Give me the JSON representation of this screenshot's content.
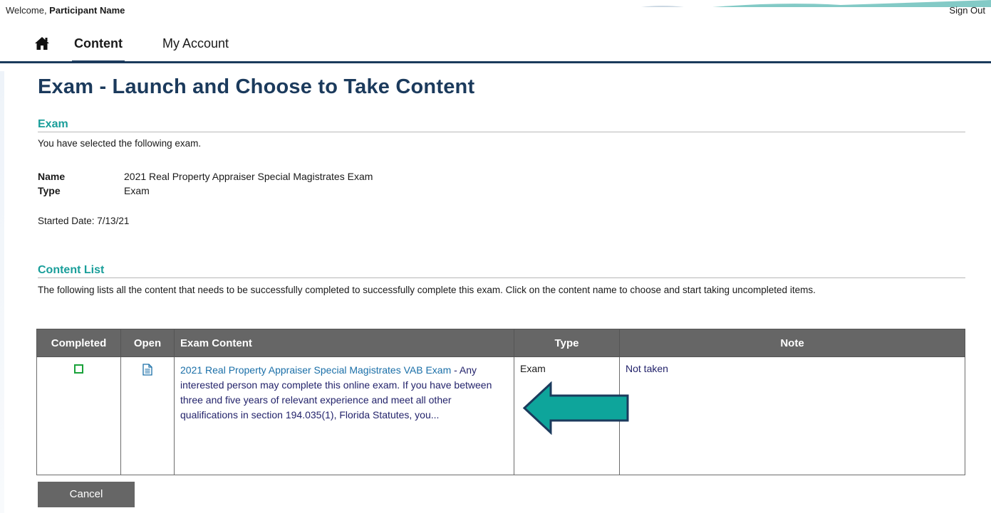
{
  "header": {
    "welcome_prefix": "Welcome, ",
    "participant_name": "Participant Name",
    "sign_out": "Sign Out"
  },
  "nav": {
    "home_icon": "home-icon",
    "tabs": [
      {
        "label": "Content",
        "active": true
      },
      {
        "label": "My Account",
        "active": false
      }
    ]
  },
  "page": {
    "title": "Exam - Launch and Choose to Take Content"
  },
  "exam_section": {
    "heading": "Exam",
    "intro": "You have selected the following exam.",
    "name_label": "Name",
    "name_value": "2021 Real Property Appraiser Special Magistrates Exam",
    "type_label": "Type",
    "type_value": "Exam",
    "started_date": "Started Date: 7/13/21"
  },
  "content_list": {
    "heading": "Content List",
    "description": "The following lists all the content that needs to be successfully completed to successfully complete this exam. Click on the content name to choose and start taking uncompleted items.",
    "columns": [
      "Completed",
      "Open",
      "Exam Content",
      "Type",
      "Note"
    ],
    "rows": [
      {
        "completed": false,
        "open_icon": "document-icon",
        "content_link": "2021 Real Property Appraiser Special Magistrates VAB Exam",
        "content_desc": " - Any interested person may complete this online exam. If you have between three and five years of relevant experience and meet all other qualifications in section 194.035(1), Florida Statutes, you...",
        "type": "Exam",
        "note": "Not taken"
      }
    ]
  },
  "annotation": {
    "arrow_icon": "left-arrow-icon",
    "arrow_color": "#0ea59b"
  },
  "actions": {
    "cancel": "Cancel"
  },
  "colors": {
    "title": "#1b3a5c",
    "section_heading": "#199e9a",
    "table_header_bg": "#666666",
    "link": "#1a6fa8",
    "checkbox": "#19a23a"
  }
}
